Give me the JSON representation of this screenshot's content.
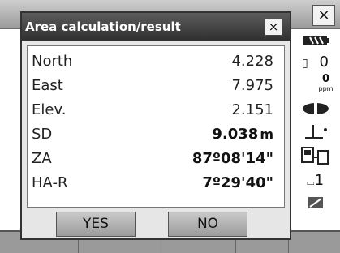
{
  "background": {
    "close_label": "×",
    "status": {
      "battery": "▐▌",
      "prism_constant": "0",
      "ppm_value": "0",
      "ppm_unit": "ppm",
      "tilt": "⊥·",
      "bluetooth": "⊕",
      "face": "1"
    }
  },
  "dialog": {
    "title": "Area calculation/result",
    "close_label": "×",
    "rows": [
      {
        "label": "North",
        "value": "4.228",
        "unit": ""
      },
      {
        "label": "East",
        "value": "7.975",
        "unit": ""
      },
      {
        "label": "Elev.",
        "value": "2.151",
        "unit": ""
      },
      {
        "label": "SD",
        "value": "9.038",
        "unit": "m"
      },
      {
        "label": "ZA",
        "value": "87º08'14\"",
        "unit": ""
      },
      {
        "label": "HA-R",
        "value": "7º29'40\"",
        "unit": ""
      }
    ],
    "buttons": {
      "yes": "YES",
      "no": "NO"
    }
  },
  "colors": {
    "title_bar": "#3f3f3f",
    "dialog_bg": "#e6e6e6",
    "panel_bg": "#ffffff"
  }
}
